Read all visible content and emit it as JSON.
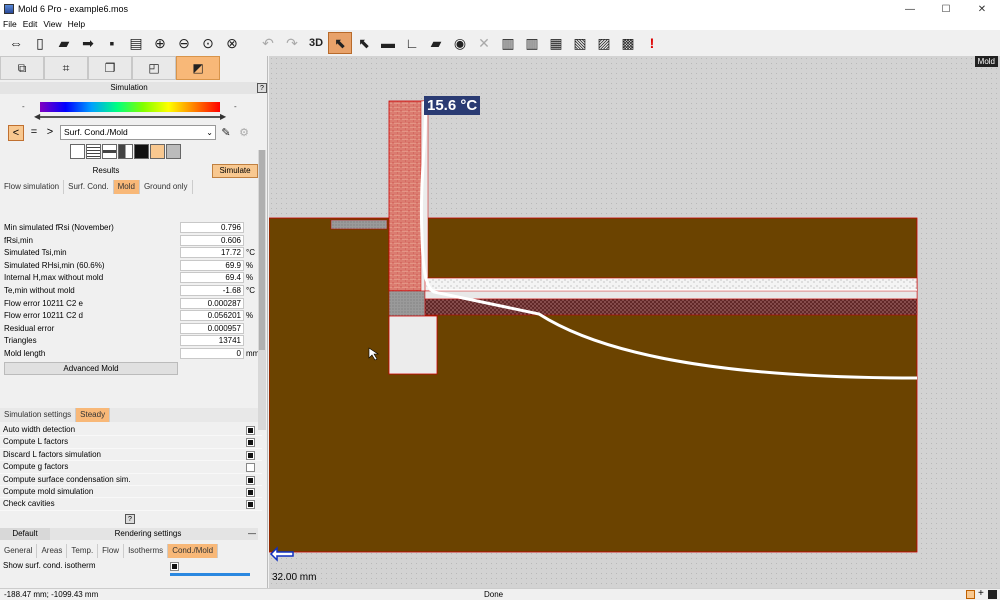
{
  "window": {
    "title": "Mold 6 Pro - example6.mos",
    "minimize": "—",
    "maximize": "☐",
    "close": "✕"
  },
  "menu": [
    "File",
    "Edit",
    "View",
    "Help"
  ],
  "toolbar": {
    "view3d_label": "3D",
    "icons": [
      "move-arrows-icon",
      "new-file-icon",
      "open-folder-icon",
      "import-icon",
      "save-icon",
      "print-icon",
      "zoom-in-icon",
      "zoom-out-icon",
      "zoom-fit-icon",
      "zoom-window-icon",
      "undo-icon",
      "redo-icon",
      "select-pointer-icon",
      "select-add-icon",
      "ruler-icon",
      "angle-icon",
      "comment-icon",
      "eye-icon",
      "grid-off-icon",
      "chart-bars-icon",
      "chart-bars2-icon",
      "chart-fill-icon",
      "lt-chart-icon",
      "gt-chart-icon",
      "chart-dots-icon",
      "warning-exclamation-icon"
    ]
  },
  "left_panel": {
    "mode_tabs": [
      "geometry-icon",
      "crop-icon",
      "layers-icon",
      "material-icon",
      "simulation-mode-icon"
    ],
    "simulation_header": "Simulation",
    "help_button": "?",
    "slider_min_label": "-",
    "slider_max_label": "-",
    "nav": {
      "prev": "<",
      "equal": "=",
      "next": ">"
    },
    "mode_select_value": "Surf. Cond./Mold",
    "results_label": "Results",
    "simulate_button": "Simulate",
    "result_tabs": [
      "Flow simulation",
      "Surf. Cond.",
      "Mold",
      "Ground only"
    ],
    "active_result_tab": "Mold",
    "results": [
      {
        "label": "Min simulated fRsi (November)",
        "value": "0.796",
        "unit": ""
      },
      {
        "label": "fRsi,min",
        "value": "0.606",
        "unit": ""
      },
      {
        "label": "Simulated Tsi,min",
        "value": "17.72",
        "unit": "°C"
      },
      {
        "label": "Simulated RHsi,min (60.6%)",
        "value": "69.9",
        "unit": "%"
      },
      {
        "label": "Internal H,max without mold",
        "value": "69.4",
        "unit": "%"
      },
      {
        "label": "Te,min without mold",
        "value": "-1.68",
        "unit": "°C"
      },
      {
        "label": "Flow error 10211 C2 e",
        "value": "0.000287",
        "unit": ""
      },
      {
        "label": "Flow error 10211 C2 d",
        "value": "0.056201",
        "unit": "%"
      },
      {
        "label": "Residual error",
        "value": "0.000957",
        "unit": ""
      },
      {
        "label": "Triangles",
        "value": "13741",
        "unit": ""
      },
      {
        "label": "Mold length",
        "value": "0",
        "unit": "mm"
      }
    ],
    "advanced_mold_button": "Advanced Mold",
    "sim_settings_tabs": [
      "Simulation settings",
      "Steady"
    ],
    "active_sim_settings_tab": "Steady",
    "sim_settings": [
      {
        "label": "Auto width detection",
        "checked": true
      },
      {
        "label": "Compute L factors",
        "checked": true
      },
      {
        "label": "Discard L factors simulation",
        "checked": true
      },
      {
        "label": "Compute g factors",
        "checked": false
      },
      {
        "label": "Compute surface condensation sim.",
        "checked": true
      },
      {
        "label": "Compute mold simulation",
        "checked": true
      },
      {
        "label": "Check cavities",
        "checked": true
      }
    ],
    "sim_help_button": "?",
    "default_label": "Default",
    "rendering_settings_label": "Rendering settings",
    "collapse_button": "—",
    "render_tabs": [
      "General",
      "Areas",
      "Temp.",
      "Flow",
      "Isotherms",
      "Cond./Mold"
    ],
    "active_render_tab": "Cond./Mold",
    "show_isotherm_label": "Show surf. cond. isotherm",
    "show_isotherm_checked": true
  },
  "canvas": {
    "mode_badge": "Mold",
    "temperature_label": "15.6 °C",
    "scale_label": "32.00 mm",
    "colors": {
      "soil": "#6b4300",
      "brick": "#d88b7a",
      "brick_lines": "#b02020",
      "insulation": "#f2f2f2",
      "isotherm": "#ffffff",
      "temp_badge": "#2a3b73"
    }
  },
  "status": {
    "coords": "-188.47 mm; -1099.43 mm",
    "state": "Done"
  }
}
